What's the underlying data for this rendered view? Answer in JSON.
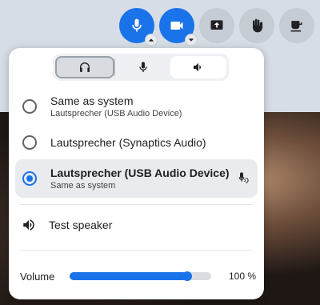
{
  "toolbar": {
    "buttons": [
      {
        "name": "microphone",
        "style": "primary",
        "has_caret": true
      },
      {
        "name": "camera",
        "style": "primary",
        "has_caret": true
      },
      {
        "name": "share-screen",
        "style": "secondary",
        "has_caret": false
      },
      {
        "name": "raise-hand",
        "style": "secondary",
        "has_caret": false
      },
      {
        "name": "coffee-break",
        "style": "secondary",
        "has_caret": false
      }
    ]
  },
  "panel": {
    "tabs": [
      {
        "icon": "headphones-icon",
        "state": "selected"
      },
      {
        "icon": "microphone-icon",
        "state": "normal"
      },
      {
        "icon": "speaker-icon",
        "state": "highlighted"
      }
    ],
    "options": [
      {
        "title": "Same as system",
        "subtitle": "Lautsprecher (USB Audio Device)",
        "selected": false
      },
      {
        "title": "Lautsprecher (Synaptics Audio)",
        "subtitle": "",
        "selected": false
      },
      {
        "title": "Lautsprecher (USB Audio Device)",
        "subtitle": "Same as system",
        "selected": true
      }
    ],
    "test_speaker": "Test speaker",
    "volume": {
      "label": "Volume",
      "value": 100,
      "display": "100 %",
      "fill_fraction": 0.83
    }
  },
  "colors": {
    "accent": "#1a73e8",
    "toolbar_secondary": "#c6ccd4",
    "selected_row": "#e9ebef"
  }
}
